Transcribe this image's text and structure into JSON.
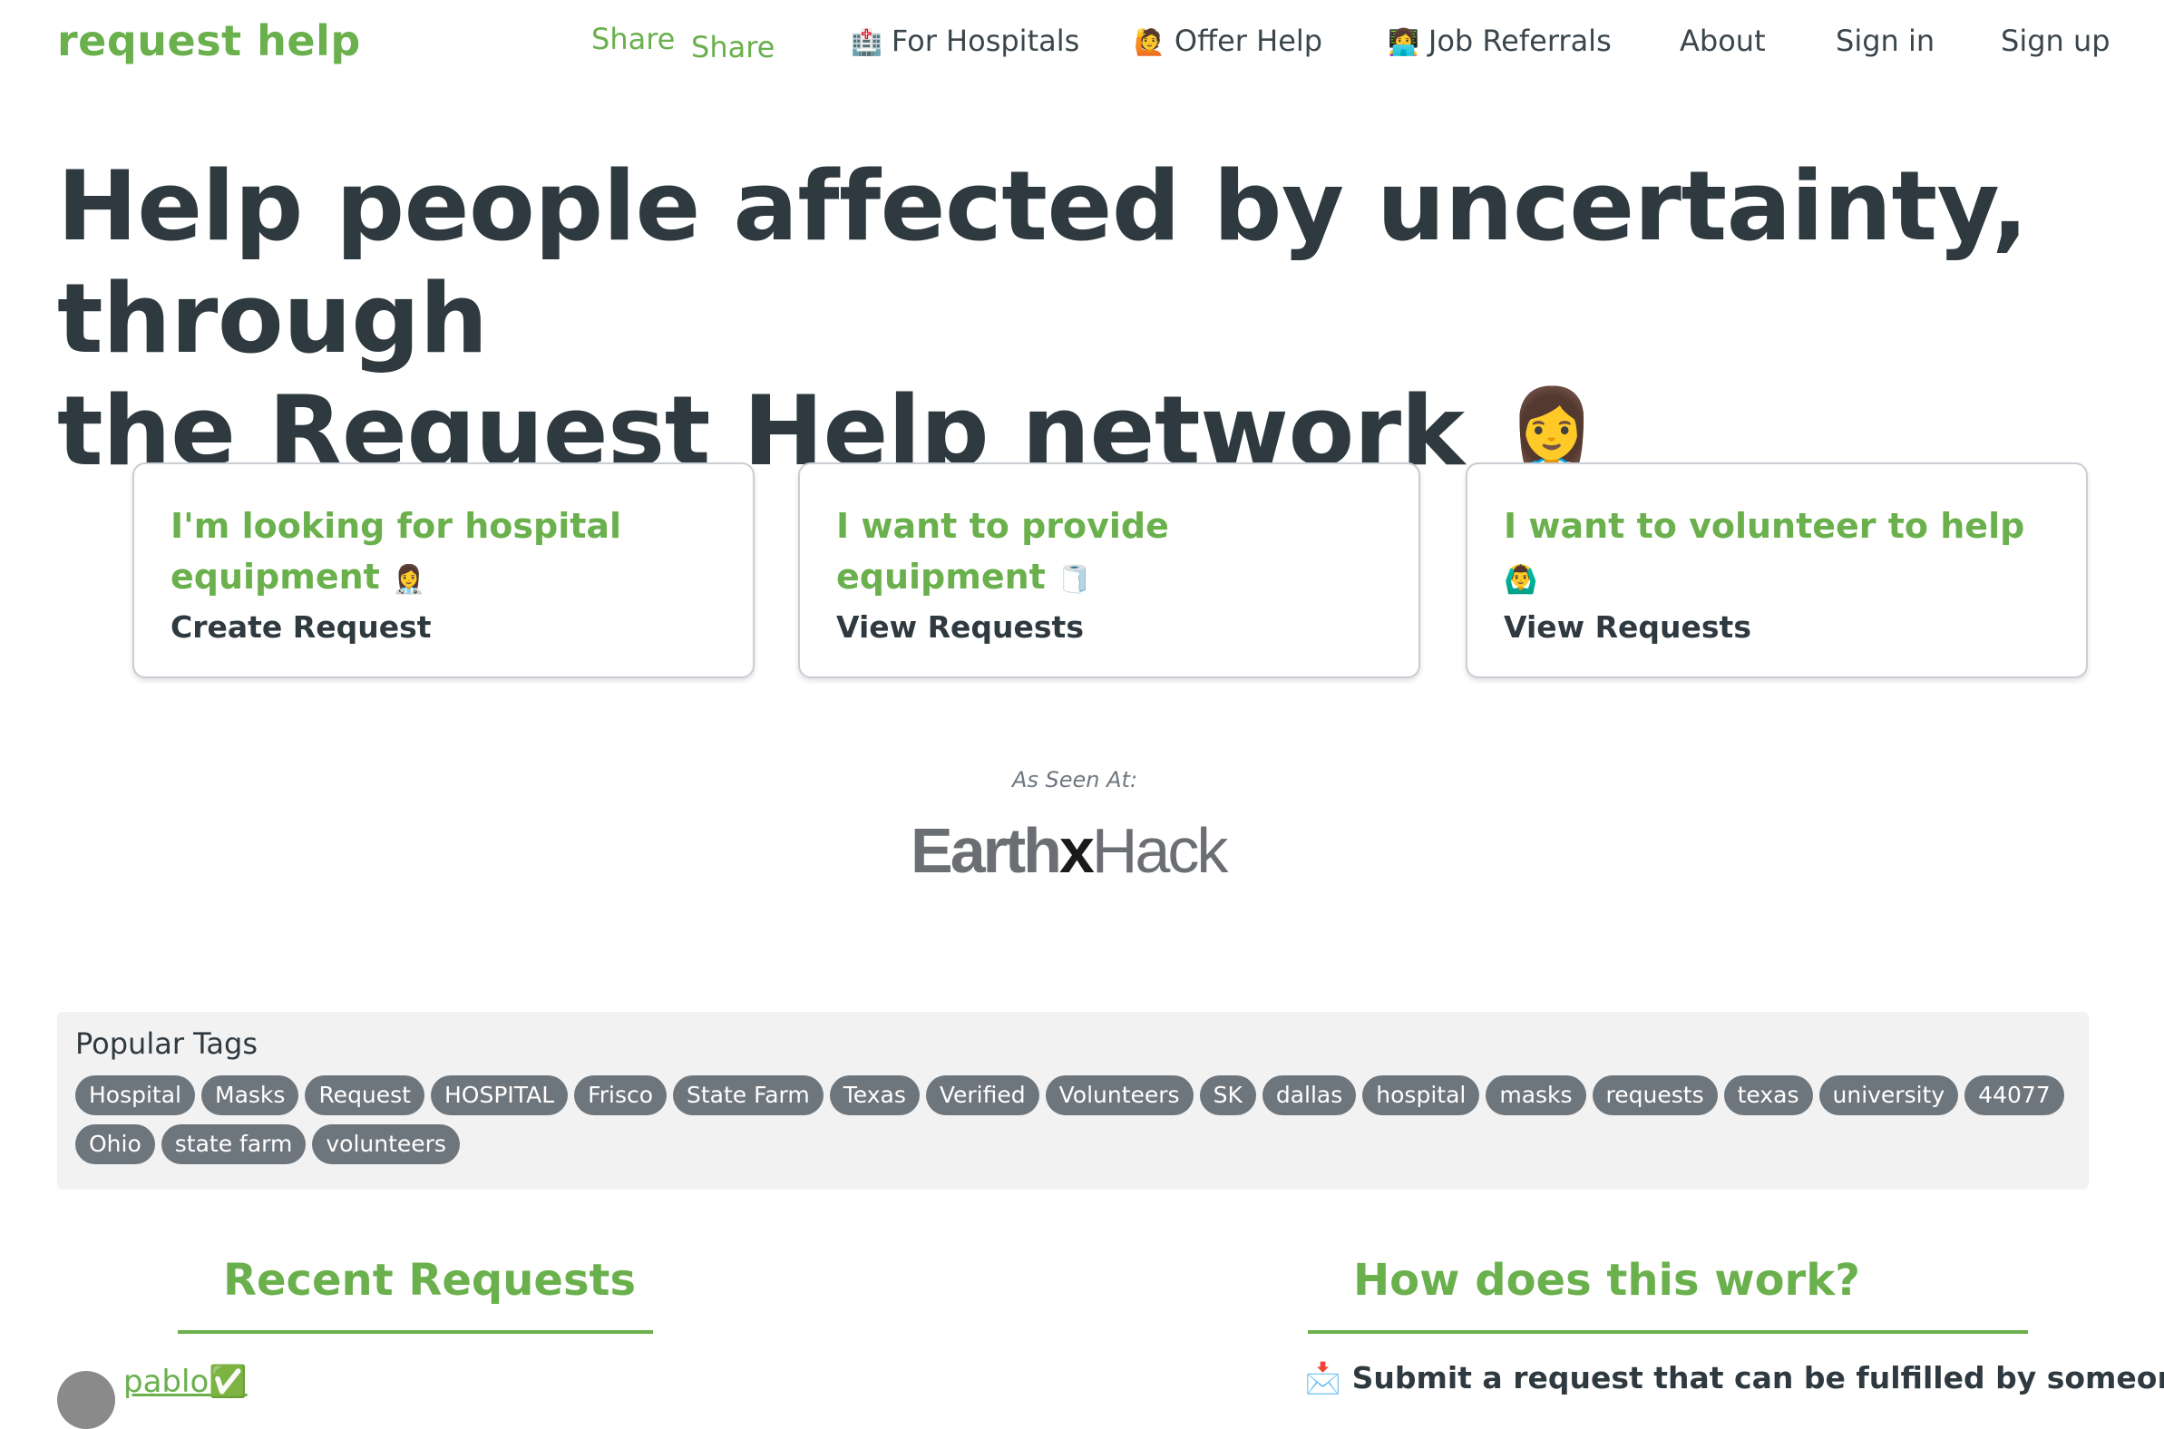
{
  "nav": {
    "brand": "request help",
    "share_1": "Share",
    "share_2": "Share",
    "hospitals_icon": "🏥",
    "hospitals": "For Hospitals",
    "offer_icon": "🙋",
    "offer": "Offer Help",
    "jobs_icon": "👩‍💻",
    "jobs": "Job Referrals",
    "about": "About",
    "signin": "Sign in",
    "signup": "Sign up"
  },
  "hero": {
    "line1": "Help people affected by uncertainty, through",
    "line2": "the Request Help network",
    "emoji": "👩‍⚕️"
  },
  "cards": [
    {
      "title_a": "I'm looking for hospital",
      "title_b": "equipment",
      "emoji": "👩‍⚕️",
      "action": "Create Request"
    },
    {
      "title_a": "I want to provide equipment",
      "emoji": "🧻",
      "action": "View Requests"
    },
    {
      "title_a": "I want to volunteer to help",
      "emoji": "🙆‍♂️",
      "action": "View Requests"
    }
  ],
  "seen": {
    "label": "As Seen At:",
    "logo_a": "Earth",
    "logo_x": "x",
    "logo_b": "Hack"
  },
  "tags": {
    "label": "Popular Tags",
    "items": [
      "Hospital",
      "Masks",
      "Request",
      "HOSPITAL",
      "Frisco",
      "State Farm",
      "Texas",
      "Verified",
      "Volunteers",
      "SK",
      "dallas",
      "hospital",
      "masks",
      "requests",
      "texas",
      "university",
      "44077",
      "Ohio",
      "state farm",
      "volunteers"
    ]
  },
  "recent": {
    "heading": "Recent Requests",
    "first_user": "pablo✅"
  },
  "how": {
    "heading": "How does this work?",
    "step_icon": "📩",
    "step1": "Submit a request that can be fulfilled by someone in"
  }
}
